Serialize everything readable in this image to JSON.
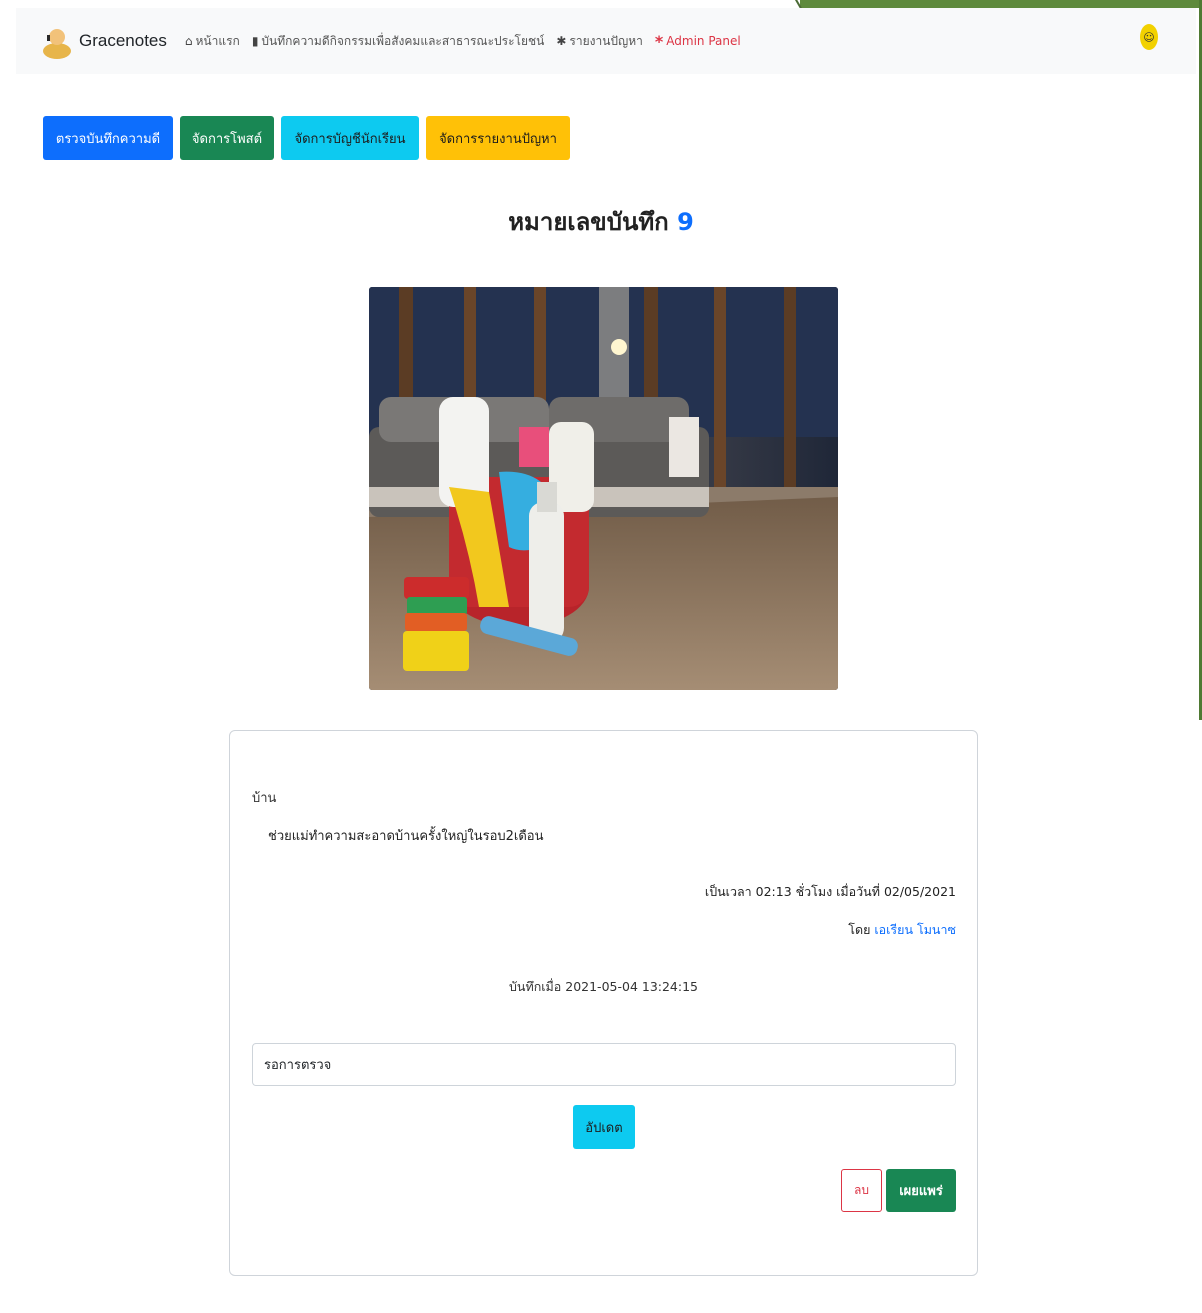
{
  "navbar": {
    "brand": "Gracenotes",
    "links": [
      {
        "icon": "home-icon",
        "label": "หน้าแรก"
      },
      {
        "icon": "notebook-icon",
        "label": "บันทึกความดีกิจกรรมเพื่อสังคมและสาธารณะประโยชน์"
      },
      {
        "icon": "bug-icon",
        "label": "รายงานปัญหา"
      },
      {
        "icon": "asterisk-icon",
        "label": "Admin Panel"
      }
    ]
  },
  "admin_buttons": {
    "check_notes": "ตรวจบันทึกความดี",
    "manage_posts": "จัดการโพสต์",
    "manage_students": "จัดการบัญชีนักเรียน",
    "manage_reports": "จัดการรายงานปัญหา"
  },
  "record": {
    "title_prefix": "หมายเลขบันทึก",
    "number": "9"
  },
  "card": {
    "category": "บ้าน",
    "description": "ช่วยแม่ทำความสะอาดบ้านครั้งใหญ่ในรอบ2เดือน",
    "duration": "เป็นเวลา 02:13 ชั่วโมง เมื่อวันที่ 02/05/2021",
    "by_prefix": "โดย",
    "author": "เอเรียน โมนาซ",
    "recorded_at": "บันทึกเมื่อ 2021-05-04 13:24:15",
    "status_value": "รอการตรวจ",
    "update_label": "อัปเดต",
    "delete_label": "ลบ",
    "publish_label": "เผยแพร่"
  },
  "colors": {
    "primary": "#0d6efd",
    "success": "#198754",
    "info": "#0dcaf0",
    "warning": "#ffc107",
    "danger": "#dc3545"
  }
}
